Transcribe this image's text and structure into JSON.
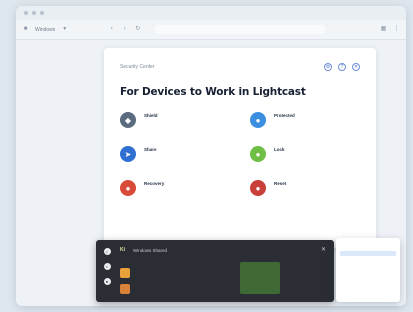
{
  "browser": {
    "tab_label": "Windows",
    "url": "",
    "nav_back": "‹",
    "nav_forward": "›",
    "refresh": "↻"
  },
  "sidebar": {
    "items": [
      "",
      ""
    ]
  },
  "card": {
    "crumb": "Security Center",
    "title": "For Devices to Work in Lightcast",
    "subtitle": "",
    "actions": [
      "⚙",
      "?",
      "✕"
    ],
    "items": [
      {
        "title": "Shield",
        "desc": "",
        "icon": "shield-icon",
        "color": "#5b6b80"
      },
      {
        "title": "Protected",
        "desc": "",
        "icon": "globe-icon",
        "color": "#3c8fe0"
      },
      {
        "title": "Share",
        "desc": "",
        "icon": "share-icon",
        "color": "#2f6fd1"
      },
      {
        "title": "Lock",
        "desc": "",
        "icon": "lock-icon",
        "color": "#6fbf46"
      },
      {
        "title": "Recovery",
        "desc": "",
        "icon": "recovery-icon",
        "color": "#d84b3a"
      },
      {
        "title": "Reset",
        "desc": "",
        "icon": "reset-icon",
        "color": "#c93f3a"
      }
    ]
  },
  "panel": {
    "app": "Ki",
    "name": "Windows Shared",
    "badge": "",
    "close": "✕",
    "files": [
      {
        "name": "",
        "meta": "",
        "color": "#e8a13b"
      },
      {
        "name": "",
        "meta": "",
        "color": "#d9823a"
      }
    ],
    "preview_label": "",
    "rail_icons": [
      "•",
      "▪",
      "●"
    ]
  },
  "popup": {
    "items": [
      "",
      "",
      "",
      "",
      ""
    ]
  }
}
